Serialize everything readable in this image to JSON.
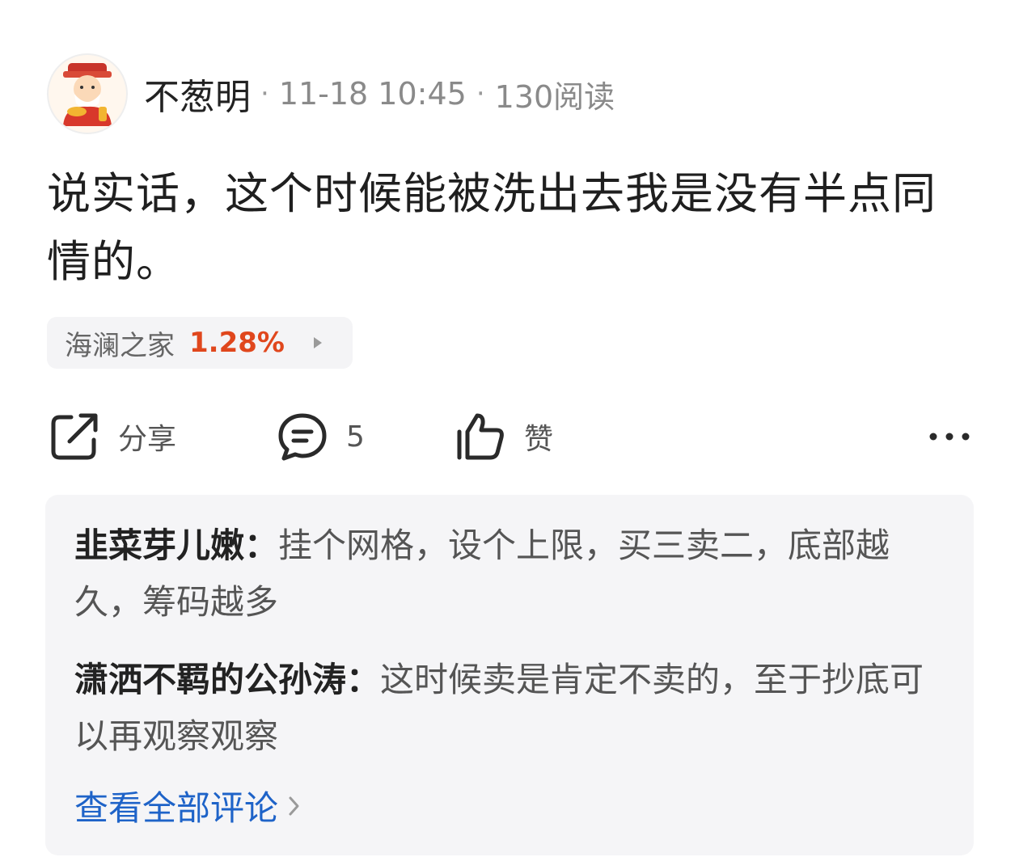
{
  "post": {
    "author": "不葱明",
    "time": "11-18 10:45",
    "reads": "130阅读",
    "text": "说实话，这个时候能被洗出去我是没有半点同情的。"
  },
  "stock_tag": {
    "name": "海澜之家",
    "change": "1.28%",
    "change_color": "#e0471d"
  },
  "actions": {
    "share_label": "分享",
    "comment_count": "5",
    "like_label": "赞"
  },
  "comments": [
    {
      "author": "韭菜芽儿嫩：",
      "text": "挂个网格，设个上限，买三卖二，底部越久，筹码越多"
    },
    {
      "author": "潇洒不羁的公孙涛：",
      "text": "这时候卖是肯定不卖的，至于抄底可以再观察观察"
    }
  ],
  "view_all": "查看全部评论",
  "colors": {
    "link": "#1e63c8",
    "accent_red": "#e0471d"
  }
}
